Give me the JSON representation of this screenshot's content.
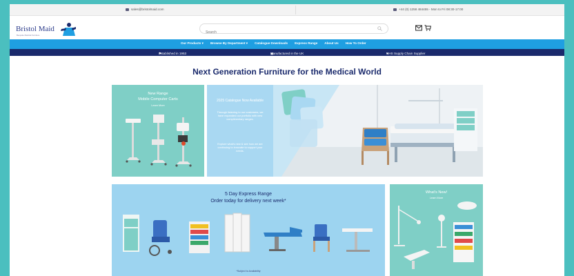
{
  "topbar": {
    "email": "sales@bristolmaid.com",
    "phone": "+44 (0) 1258 484455 - Mon to Fri 08:30-17:00"
  },
  "header": {
    "logo_text": "Bristol Maid",
    "logo_tagline": "Bespoke Medical Furniture",
    "search_placeholder": "Search"
  },
  "nav": {
    "items": [
      "Our Products ▾",
      "Browse By Department ▾",
      "Catalogue Downloads",
      "Express Range",
      "About Us",
      "How To Order"
    ]
  },
  "usp": {
    "established": "Established in 1953",
    "manufactured": "Manufactured in the UK",
    "nhs": "NHS Supply Chain Supplier"
  },
  "hero": {
    "title": "Next Generation Furniture for the Medical World"
  },
  "tiles": {
    "new_range": {
      "line1": "New Range",
      "line2": "Mobile Computer Carts",
      "link": "Learn More"
    },
    "catalogue": {
      "title": "2025 Catalogue Now Available",
      "para1": "Through listening to our customers, we have expanded our portfolio with new complimentary ranges.",
      "para2": "Explore what's new & see how we are continuing to innovate to support your needs."
    },
    "express": {
      "line1": "5 Day Express Range",
      "line2": "Order today for delivery next week*",
      "footnote": "*Subject to Availability"
    },
    "whats_new": {
      "title": "What's New!",
      "link": "Learn More"
    }
  },
  "colors": {
    "outer_bg": "#4bbfbf",
    "nav_blue": "#1f9fe2",
    "usp_navy": "#1a2a6c",
    "teal_tile": "#7fcfc6",
    "light_blue_tile": "#a9d8f2"
  }
}
